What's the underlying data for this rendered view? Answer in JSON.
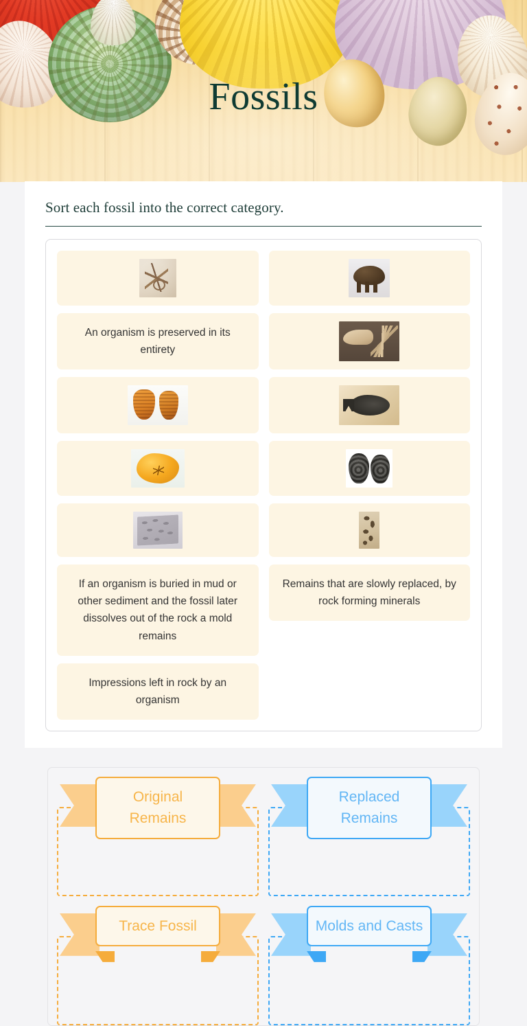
{
  "header": {
    "title": "Fossils",
    "decor": [
      "red-scallop-shell",
      "white-spiral-conch",
      "green-turban-shell",
      "brown-striped-conch",
      "yellow-scallop-shell",
      "lavender-scallop-shell",
      "golden-clam-shell",
      "olive-clam-shell",
      "cream-spiral-conch",
      "spotted-cone-shell"
    ]
  },
  "worksheet": {
    "instructions": "Sort each fossil into the correct category."
  },
  "item_pool": {
    "left_column": [
      {
        "type": "image",
        "icon": "skeleton-in-rock-slab-image",
        "label": ""
      },
      {
        "type": "text",
        "icon": "",
        "label": "An organism is preserved in its entirety"
      },
      {
        "type": "image",
        "icon": "orange-trilobite-pair-image",
        "label": ""
      },
      {
        "type": "image",
        "icon": "amber-resin-nodule-image",
        "label": ""
      },
      {
        "type": "image",
        "icon": "gray-trace-impression-slab-image",
        "label": ""
      },
      {
        "type": "text",
        "icon": "",
        "label": "If an organism is buried in mud or other sediment and the fossil later dissolves out of the rock a mold remains"
      },
      {
        "type": "text",
        "icon": "",
        "label": "Impressions left in rock by an organism"
      }
    ],
    "right_column": [
      {
        "type": "image",
        "icon": "woolly-mammoth-specimen-image",
        "label": ""
      },
      {
        "type": "image",
        "icon": "trex-skull-skeleton-image",
        "label": ""
      },
      {
        "type": "image",
        "icon": "fish-fossil-slab-image",
        "label": ""
      },
      {
        "type": "image",
        "icon": "dark-ammonite-pair-image",
        "label": ""
      },
      {
        "type": "image",
        "icon": "tan-speckled-slab-image",
        "label": ""
      },
      {
        "type": "text",
        "icon": "",
        "label": "Remains that are slowly replaced, by rock forming minerals"
      }
    ]
  },
  "categories": [
    {
      "label": "Original Remains",
      "color": "orange",
      "accent": "#f5ac3c",
      "items": []
    },
    {
      "label": "Replaced Remains",
      "color": "blue",
      "accent": "#3ea8f5",
      "items": []
    },
    {
      "label": "Trace Fossil",
      "color": "orange",
      "accent": "#f5ac3c",
      "items": []
    },
    {
      "label": "Molds and Casts",
      "color": "blue",
      "accent": "#3ea8f5",
      "items": []
    }
  ],
  "colors": {
    "page_background": "#f4f4f6",
    "card_background": "#fdf5e3",
    "title_text": "#0f3b33",
    "body_text": "#343434",
    "orange_accent": "#f5ac3c",
    "blue_accent": "#3ea8f5"
  }
}
